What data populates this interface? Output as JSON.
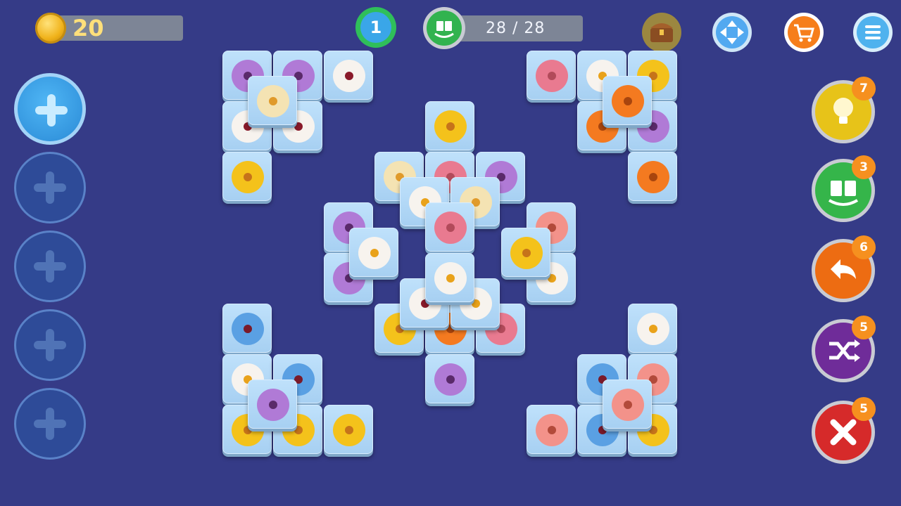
{
  "hud": {
    "coins": "20",
    "level": "1",
    "pairs_progress": "28 / 28"
  },
  "top_buttons": [
    {
      "name": "treasure-chest",
      "icon": "chest-icon"
    },
    {
      "name": "move-view",
      "icon": "move-arrows-icon"
    },
    {
      "name": "shop",
      "icon": "cart-icon"
    },
    {
      "name": "menu",
      "icon": "hamburger-icon"
    }
  ],
  "slots": [
    {
      "state": "active",
      "icon": "plus-icon"
    },
    {
      "state": "locked",
      "icon": "plus-icon"
    },
    {
      "state": "locked",
      "icon": "plus-icon"
    },
    {
      "state": "locked",
      "icon": "plus-icon"
    },
    {
      "state": "locked",
      "icon": "plus-icon"
    }
  ],
  "powerups": [
    {
      "name": "hint",
      "icon": "lightbulb-icon",
      "count": "7",
      "color": "#e7c319"
    },
    {
      "name": "refresh",
      "icon": "cards-refresh-icon",
      "count": "3",
      "color": "#35b54a"
    },
    {
      "name": "undo",
      "icon": "undo-arrow-icon",
      "count": "6",
      "color": "#ed6c12"
    },
    {
      "name": "shuffle",
      "icon": "shuffle-icon",
      "count": "5",
      "color": "#6f2c99"
    },
    {
      "name": "remove",
      "icon": "close-x-icon",
      "count": "5",
      "color": "#d62a2a"
    }
  ],
  "tile_colors": {
    "purple": "#b07ad6",
    "white": "#f7f3ee",
    "cream": "#f4e3b3",
    "yellow": "#f4c21b",
    "pink": "#e97a90",
    "orange": "#f47a20",
    "blue": "#5aa0e3",
    "salmon": "#f3928a"
  }
}
